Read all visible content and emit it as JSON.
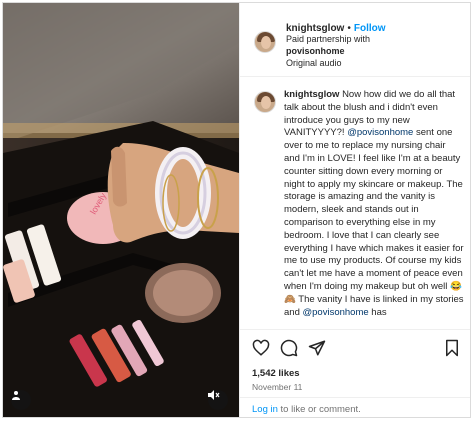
{
  "post": {
    "username": "knightsglow",
    "follow_label": "Follow",
    "separator": "•",
    "partnership_prefix": "Paid partnership with",
    "partner": "povisonhome",
    "audio": "Original audio"
  },
  "caption": {
    "username": "knightsglow",
    "text_1": "Now how did we do all that talk about the blush and i didn't even introduce you guys to my new VANITYYYY?! ",
    "mention_1": "@povisonhome",
    "text_2": " sent one over to me to replace my nursing chair and I'm in LOVE! I feel like I'm at a beauty counter sitting down every morning or night to apply my skincare or makeup. The storage is amazing and the vanity is modern, sleek and stands out in comparison to everything else in my bedroom. I love that I can clearly see everything I have which makes it easier for me to use my products. Of course my kids can't let me have a moment of peace even when I'm doing my makeup but oh well 😂 🙈 The vanity I have is linked in my stories and ",
    "mention_2": "@povisonhome",
    "text_3": " has"
  },
  "engagement": {
    "likes": "1,542 likes",
    "date": "November 11"
  },
  "footer": {
    "login_link": "Log in",
    "login_rest": " to like or comment."
  },
  "icons": {
    "like": "heart-icon",
    "comment": "comment-icon",
    "share": "share-icon",
    "save": "bookmark-icon",
    "audio": "user-tag-icon",
    "mute": "speaker-muted-icon"
  },
  "colors": {
    "link": "#0095f6",
    "mention": "#00376b",
    "text": "#262626",
    "secondary": "#737373"
  }
}
